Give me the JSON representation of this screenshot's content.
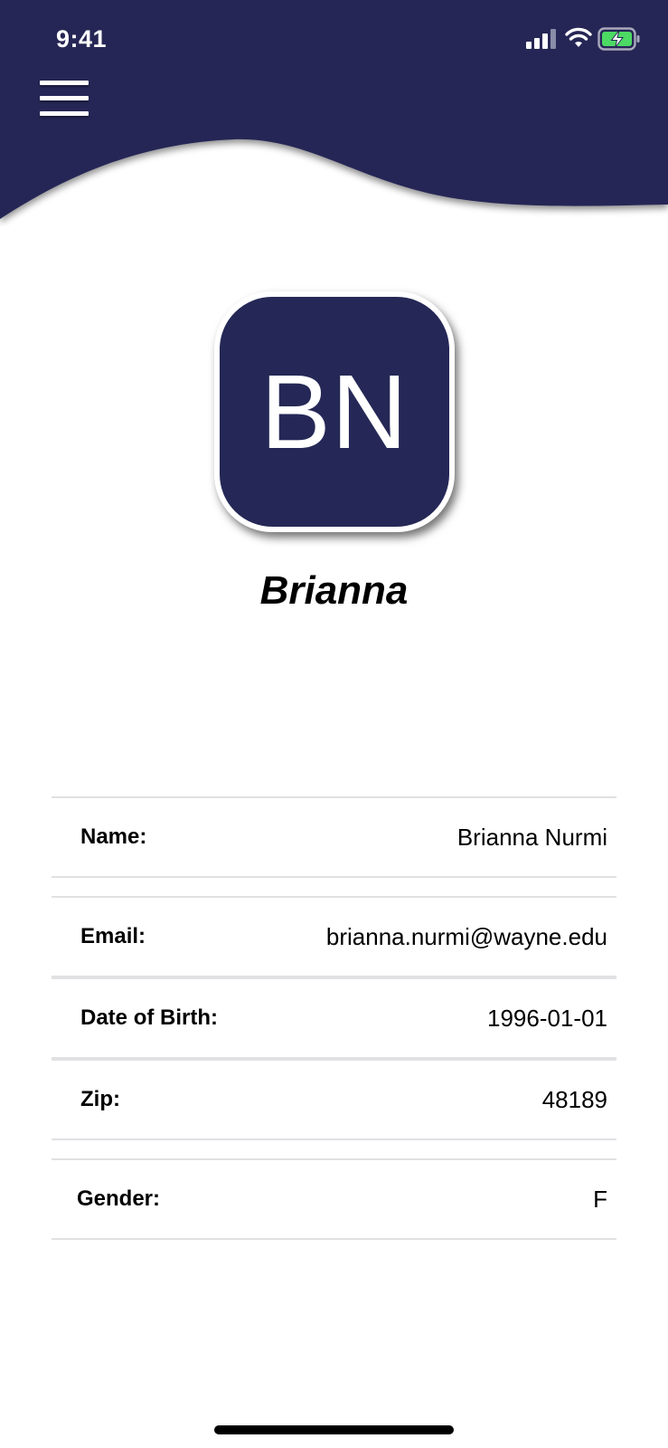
{
  "status_bar": {
    "time": "9:41",
    "icons": [
      "signal-icon",
      "wifi-icon",
      "battery-charging-icon"
    ]
  },
  "header": {
    "color": "#252856",
    "menu_icon": "hamburger-menu-icon"
  },
  "profile": {
    "initials": "BN",
    "display_name": "Brianna",
    "avatar_color": "#252856"
  },
  "details": [
    {
      "label": "Name:",
      "value": "Brianna Nurmi"
    },
    {
      "label": "Email:",
      "value": "brianna.nurmi@wayne.edu"
    },
    {
      "label": "Date of Birth:",
      "value": "1996-01-01"
    },
    {
      "label": "Zip:",
      "value": "48189"
    },
    {
      "label": "Gender:",
      "value": "F"
    }
  ]
}
